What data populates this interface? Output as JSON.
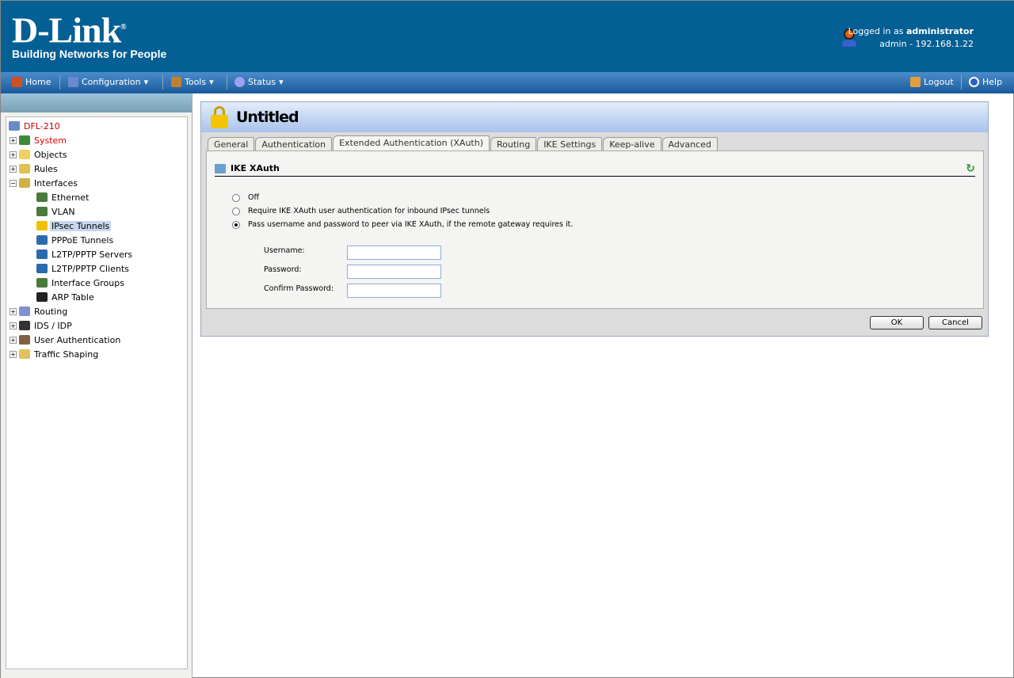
{
  "header": {
    "logo_main": "D-Link",
    "logo_reg": "®",
    "logo_tagline": "Building Networks for People",
    "logged_prefix": "Logged in as",
    "username": "administrator",
    "session": "admin - 192.168.1.22"
  },
  "menu": {
    "home": "Home",
    "configuration": "Configuration",
    "tools": "Tools",
    "status": "Status",
    "logout": "Logout",
    "help": "Help",
    "arrow": "▾"
  },
  "tree": [
    {
      "label": "DFL-210",
      "level": 0,
      "exp": "",
      "color": "#c00000",
      "icon": "#6a8ac8"
    },
    {
      "label": "System",
      "level": 0,
      "exp": "+",
      "color": "#e00000",
      "icon": "#3a8a3a"
    },
    {
      "label": "Objects",
      "level": 0,
      "exp": "+",
      "color": "#000",
      "icon": "#f0d060"
    },
    {
      "label": "Rules",
      "level": 0,
      "exp": "+",
      "color": "#000",
      "icon": "#e0c050"
    },
    {
      "label": "Interfaces",
      "level": 0,
      "exp": "−",
      "color": "#000",
      "icon": "#d0b040"
    },
    {
      "label": "Ethernet",
      "level": 1,
      "color": "#000",
      "icon": "#4a7a3a"
    },
    {
      "label": "VLAN",
      "level": 1,
      "color": "#000",
      "icon": "#4a7a3a"
    },
    {
      "label": "IPsec Tunnels",
      "level": 1,
      "color": "#000",
      "icon": "#f0c000",
      "selected": true
    },
    {
      "label": "PPPoE Tunnels",
      "level": 1,
      "color": "#000",
      "icon": "#2a6ab0"
    },
    {
      "label": "L2TP/PPTP Servers",
      "level": 1,
      "color": "#000",
      "icon": "#2a6ab0"
    },
    {
      "label": "L2TP/PPTP Clients",
      "level": 1,
      "color": "#000",
      "icon": "#2a6ab0"
    },
    {
      "label": "Interface Groups",
      "level": 1,
      "color": "#000",
      "icon": "#4a7a3a"
    },
    {
      "label": "ARP Table",
      "level": 1,
      "color": "#000",
      "icon": "#222"
    },
    {
      "label": "Routing",
      "level": 0,
      "exp": "+",
      "color": "#000",
      "icon": "#8090d0"
    },
    {
      "label": "IDS / IDP",
      "level": 0,
      "exp": "+",
      "color": "#000",
      "icon": "#333"
    },
    {
      "label": "User Authentication",
      "level": 0,
      "exp": "+",
      "color": "#000",
      "icon": "#806040"
    },
    {
      "label": "Traffic Shaping",
      "level": 0,
      "exp": "+",
      "color": "#000",
      "icon": "#e0c060"
    }
  ],
  "panel": {
    "title": "Untitled",
    "tabs": [
      "General",
      "Authentication",
      "Extended Authentication (XAuth)",
      "Routing",
      "IKE Settings",
      "Keep-alive",
      "Advanced"
    ],
    "active_tab": 2,
    "section": "IKE XAuth",
    "options": [
      "Off",
      "Require IKE XAuth user authentication for inbound IPsec tunnels",
      "Pass username and password to peer via IKE XAuth, if the remote gateway requires it."
    ],
    "selected_option": 2,
    "fields": [
      {
        "label": "Username:",
        "value": ""
      },
      {
        "label": "Password:",
        "value": ""
      },
      {
        "label": "Confirm Password:",
        "value": ""
      }
    ],
    "ok": "OK",
    "cancel": "Cancel"
  }
}
